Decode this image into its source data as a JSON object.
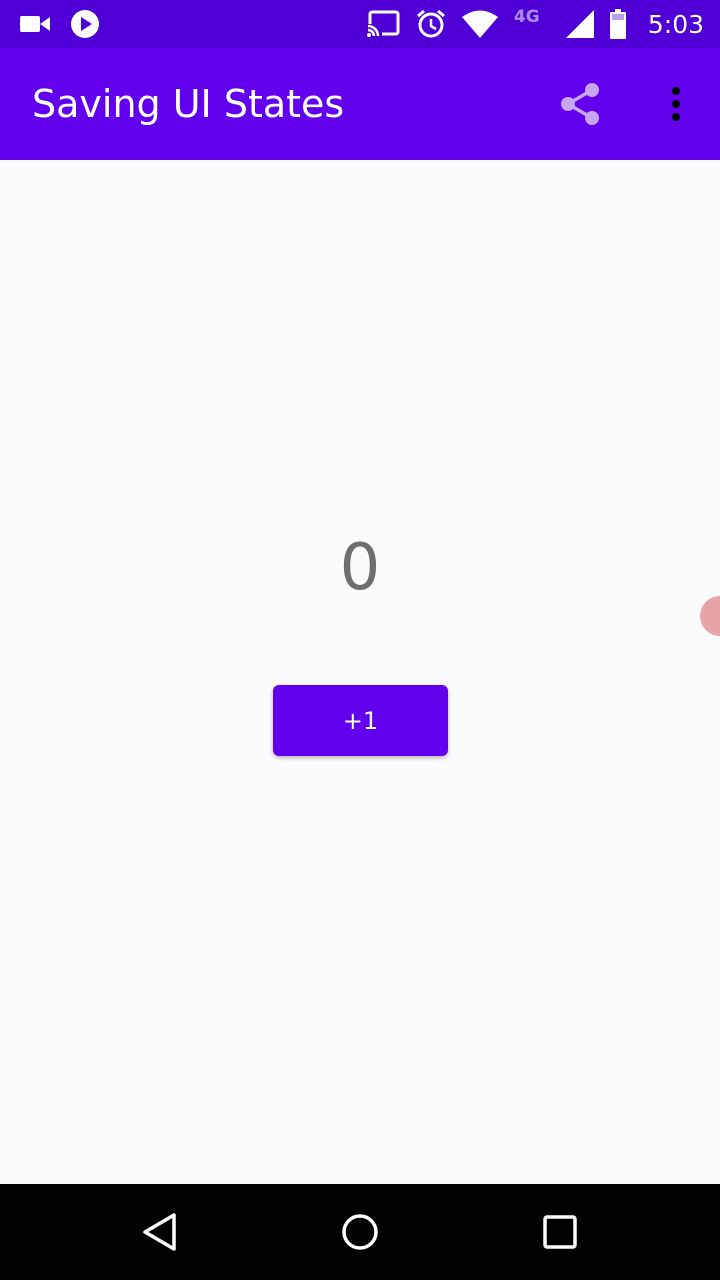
{
  "status_bar": {
    "time": "5:03",
    "network_type": "4G",
    "icons": [
      "video-camera-icon",
      "play-icon",
      "cast-icon",
      "alarm-icon",
      "wifi-icon",
      "cellular-signal-icon",
      "battery-icon"
    ]
  },
  "app_bar": {
    "title": "Saving UI States",
    "actions": [
      "share-icon",
      "more-vert-icon"
    ]
  },
  "main": {
    "counter_value": "0",
    "increment_label": "+1"
  },
  "navigation_bar": {
    "buttons": [
      "back-icon",
      "home-icon",
      "recents-icon"
    ]
  },
  "colors": {
    "primary": "#6200ee",
    "status_bar": "#5000d6",
    "counter_text": "#6f6f6f",
    "background": "#fbfbfd",
    "share_icon": "#c7a6f5"
  }
}
